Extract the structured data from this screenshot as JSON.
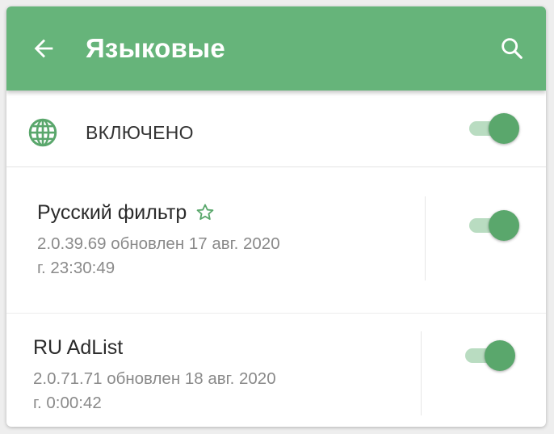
{
  "appbar": {
    "title": "Языковые",
    "back_icon": "arrow-left-icon",
    "search_icon": "search-icon",
    "color": "#66b47a"
  },
  "master": {
    "label": "ВКЛЮЧЕНО",
    "icon": "globe-icon",
    "enabled": true
  },
  "filters": [
    {
      "name": "Русский фильтр",
      "favorite_icon": "star-outline-icon",
      "version_line": "2.0.39.69 обновлен 17 авг. 2020",
      "time_line": "г. 23:30:49",
      "enabled": true
    },
    {
      "name": "RU AdList",
      "version_line": "2.0.71.71 обновлен 18 авг. 2020",
      "time_line": "г. 0:00:42",
      "enabled": true
    }
  ],
  "colors": {
    "accent": "#5aa76c",
    "track": "#b9dcc1"
  }
}
